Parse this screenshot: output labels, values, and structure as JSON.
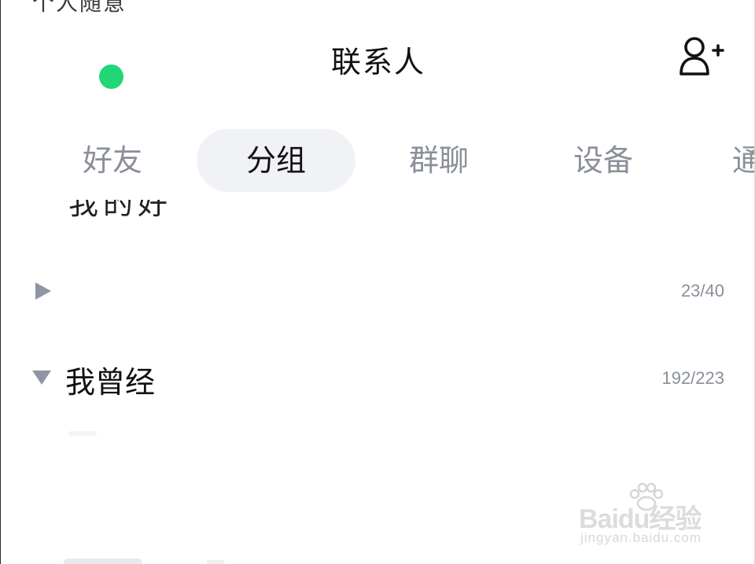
{
  "header": {
    "top_cut_text": "个人随意",
    "title": "联系人",
    "add_icon": "add-user-icon",
    "status_color": "#22d676"
  },
  "tabs": [
    {
      "label": "好友",
      "active": false
    },
    {
      "label": "分组",
      "active": true
    },
    {
      "label": "群聊",
      "active": false
    },
    {
      "label": "设备",
      "active": false
    },
    {
      "label": "通",
      "active": false
    }
  ],
  "partial_group": {
    "name": "我的好友"
  },
  "groups": [
    {
      "name": "",
      "count": "23/40",
      "expanded": false
    },
    {
      "name": "我曾经",
      "count": "192/223",
      "expanded": true
    }
  ],
  "watermark": {
    "main": "Baidu经验",
    "sub": "jingyan.baidu.com"
  }
}
